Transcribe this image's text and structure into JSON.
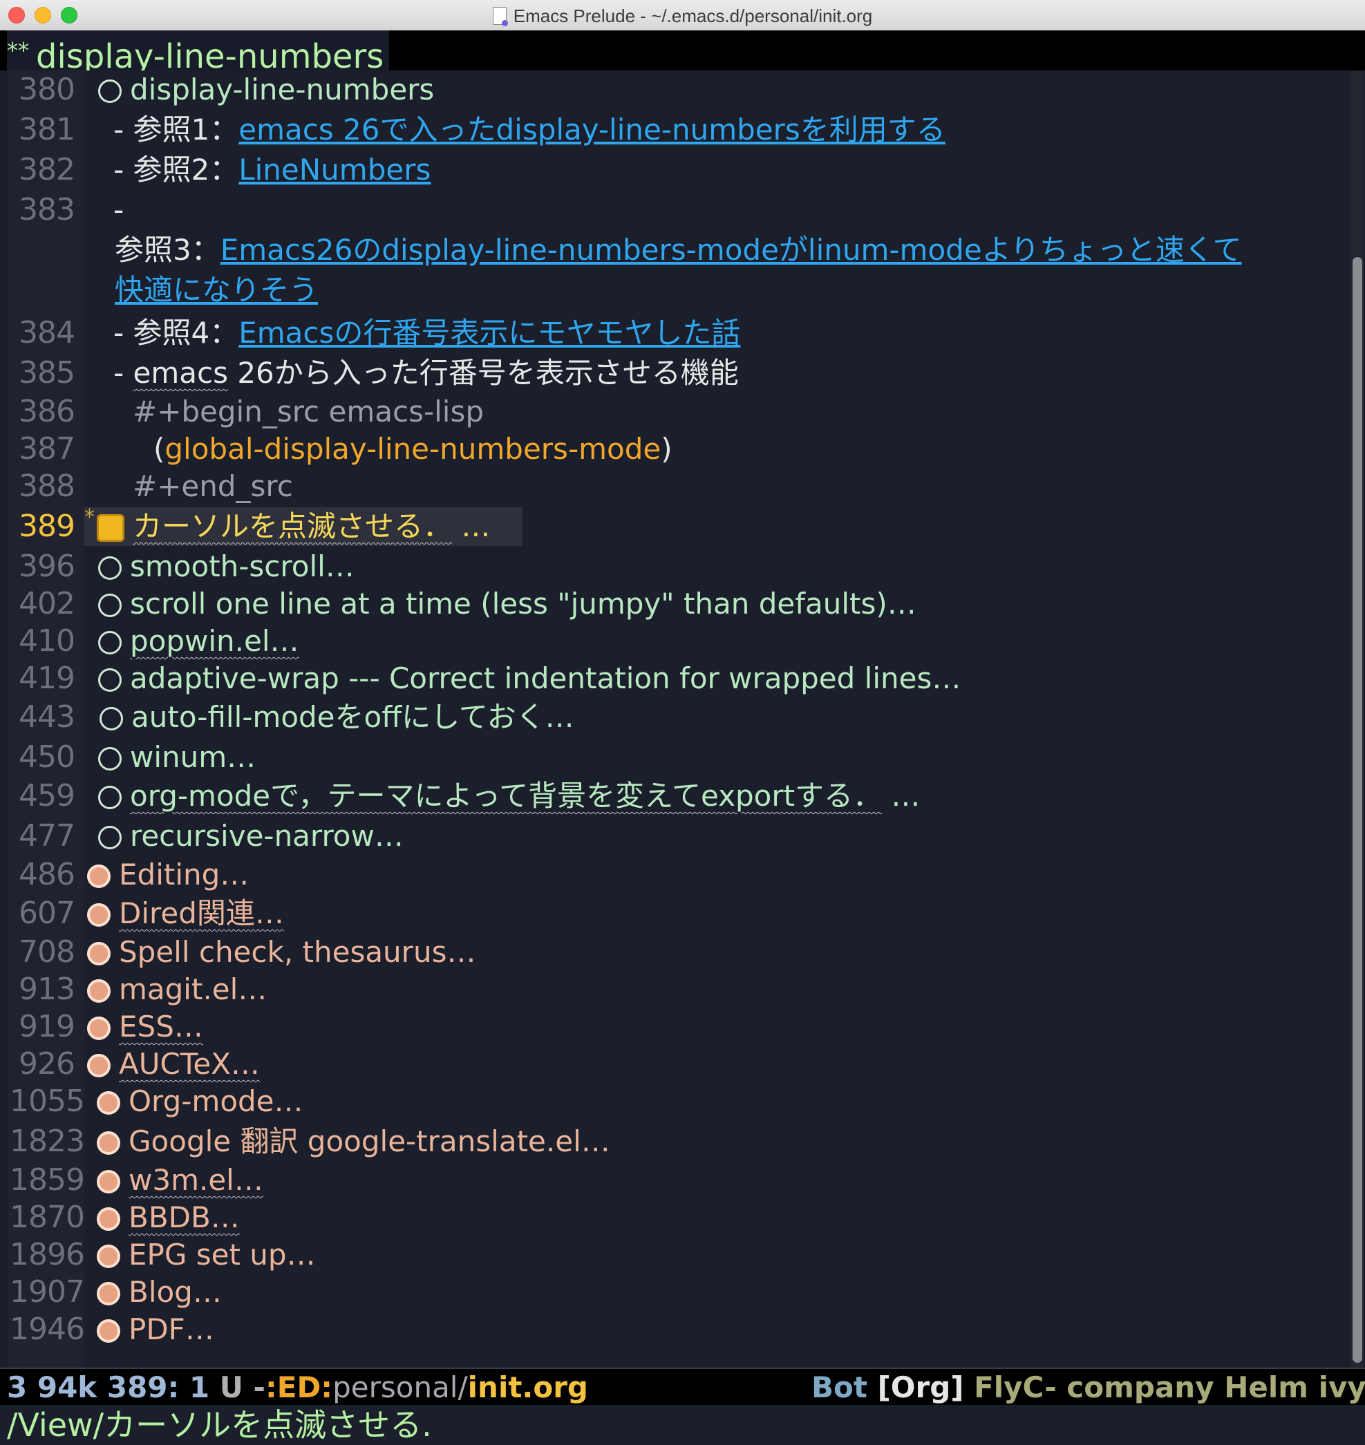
{
  "window": {
    "title": "Emacs Prelude - ~/.emacs.d/personal/init.org"
  },
  "header": {
    "stars": "**",
    "title": "display-line-numbers"
  },
  "lines": [
    {
      "num": "380",
      "text": "display-line-numbers"
    },
    {
      "num": "381",
      "prefix": "- 参照1：",
      "link": "emacs 26で入ったdisplay-line-numbersを利用する"
    },
    {
      "num": "382",
      "prefix": "- 参照2：",
      "link": "LineNumbers"
    },
    {
      "num": "383",
      "dash": "-",
      "prefix": "参照3：",
      "link_part1": "Emacs26のdisplay-line-numbers-modeがlinum-modeよりちょっと速くて",
      "link_part2": "快適になりそう"
    },
    {
      "num": "384",
      "prefix": "- 参照4：",
      "link": "Emacsの行番号表示にモヤモヤした話"
    },
    {
      "num": "385",
      "dash": "- ",
      "word": "emacs",
      "rest": " 26から入った行番号を表示させる機能"
    },
    {
      "num": "386",
      "text": "#+begin_src emacs-lisp"
    },
    {
      "num": "387",
      "open": "(",
      "fn": "global-display-line-numbers-mode",
      "close": ")"
    },
    {
      "num": "388",
      "text": "#+end_src"
    },
    {
      "num": "389",
      "marker": "*",
      "text": "カーソルを点滅させる．",
      "ellipsis": " …"
    }
  ],
  "sections": [
    {
      "num": "396",
      "text": "smooth-scroll…"
    },
    {
      "num": "402",
      "text": "scroll one line at a time (less \"jumpy\" than defaults)…"
    },
    {
      "num": "410",
      "text": "popwin.el…"
    },
    {
      "num": "419",
      "text": "adaptive-wrap --- Correct indentation for wrapped lines…"
    },
    {
      "num": "443",
      "text": "auto-fill-modeをoffにしておく…"
    },
    {
      "num": "450",
      "text": "winum…"
    },
    {
      "num": "459",
      "text": "org-modeで，テーマによって背景を変えてexportする．",
      "ellipsis": " …"
    },
    {
      "num": "477",
      "text": "recursive-narrow…"
    }
  ],
  "headings": [
    {
      "num": "486",
      "text": "Editing…"
    },
    {
      "num": "607",
      "text": "Dired関連…"
    },
    {
      "num": "708",
      "text": "Spell check, thesaurus…"
    },
    {
      "num": "913",
      "text": "magit.el…"
    },
    {
      "num": "919",
      "text": "ESS…"
    },
    {
      "num": "926",
      "text": "AUCTeX…"
    },
    {
      "num": "1055",
      "text": "Org-mode…"
    },
    {
      "num": "1823",
      "text": "Google 翻訳 google-translate.el…"
    },
    {
      "num": "1859",
      "text": "w3m.el…"
    },
    {
      "num": "1870",
      "text": "BBDB…"
    },
    {
      "num": "1896",
      "text": "EPG set up…"
    },
    {
      "num": "1907",
      "text": "Blog…"
    },
    {
      "num": "1946",
      "text": "PDF…"
    }
  ],
  "modeline": {
    "left_a": "3 94k 389: 1 ",
    "left_b": "U -",
    "left_c": ":ED:",
    "left_d": "personal/",
    "left_e": "init.org",
    "right_a": "Bot ",
    "right_b": "[Org]",
    "right_c": " FlyC- company Helm ivy E"
  },
  "minibuffer": {
    "text": "/View/カーソルを点滅させる."
  },
  "colors": {
    "background": "#1b1e2b",
    "heading_green": "#b8e8c0",
    "heading_salmon": "#e9b49a",
    "link": "#2fa6ef",
    "function": "#f1a72b",
    "current_line": "#f4c23e"
  }
}
